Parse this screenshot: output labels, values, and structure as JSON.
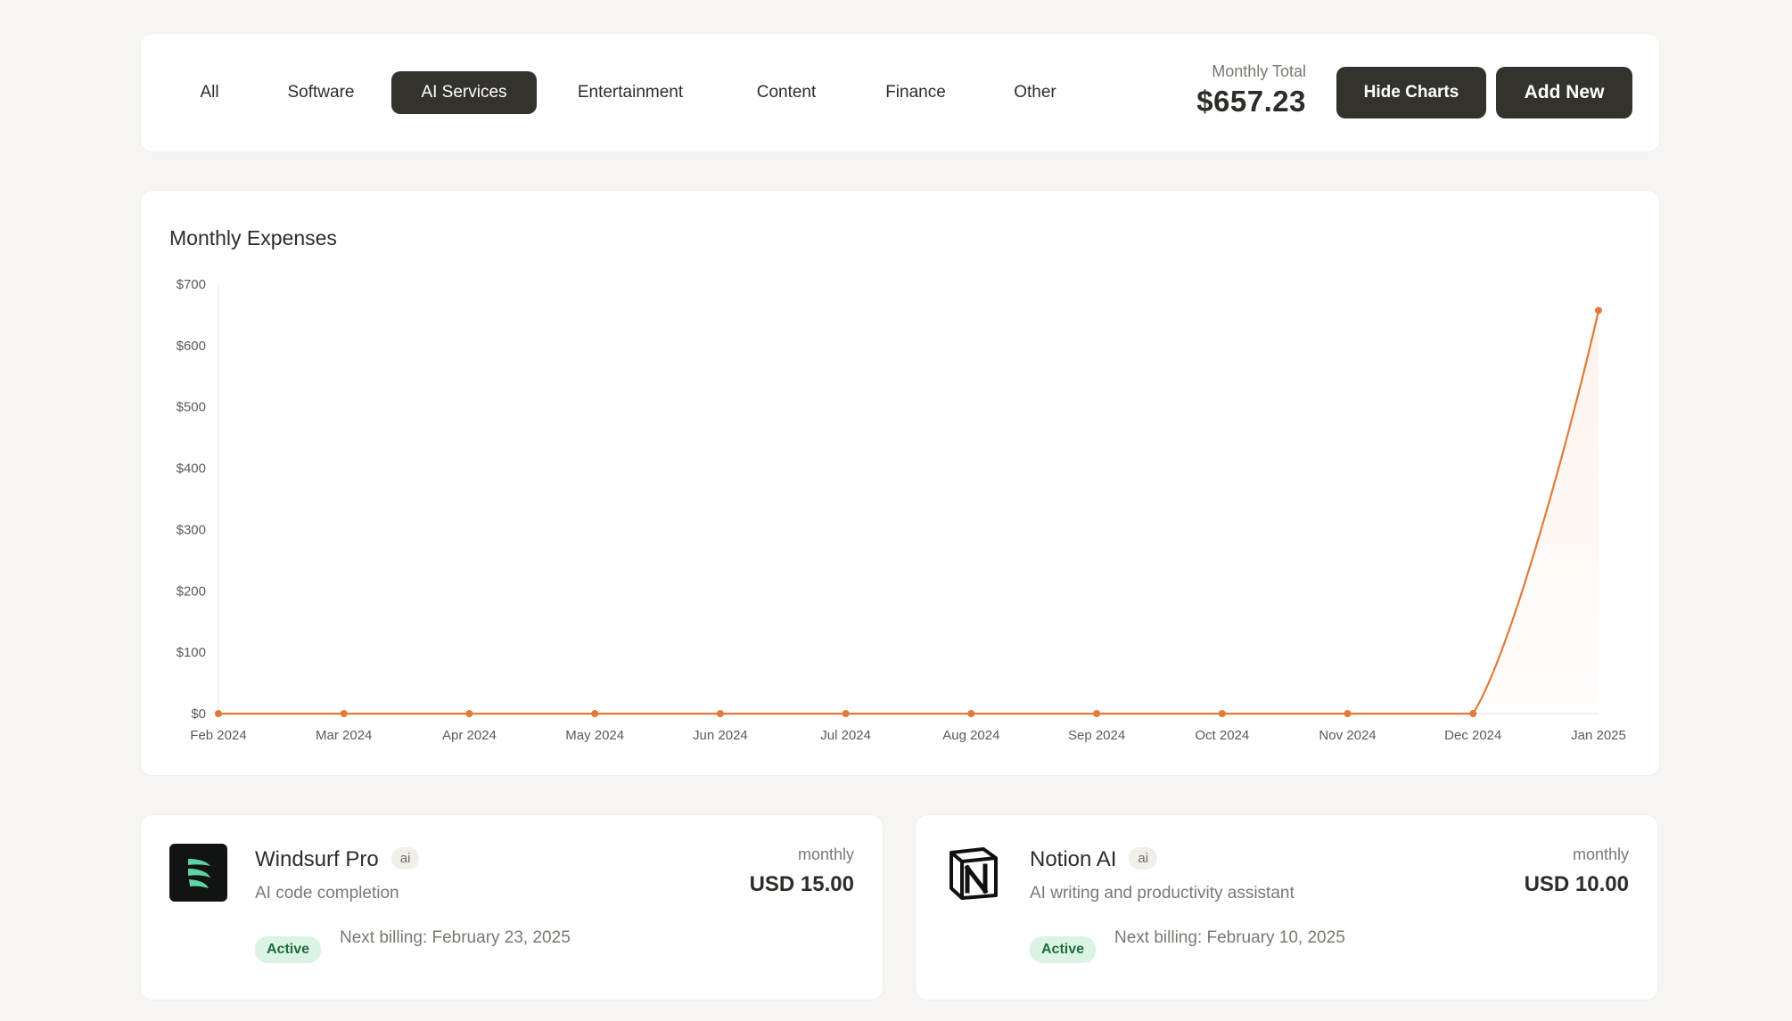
{
  "tabs": [
    {
      "label": "All"
    },
    {
      "label": "Software"
    },
    {
      "label": "AI Services",
      "active": true
    },
    {
      "label": "Entertainment"
    },
    {
      "label": "Content"
    },
    {
      "label": "Finance"
    },
    {
      "label": "Other"
    }
  ],
  "summary": {
    "total_label": "Monthly Total",
    "total_value": "$657.23"
  },
  "buttons": {
    "hide_charts": "Hide Charts",
    "add_new": "Add New"
  },
  "chart": {
    "title": "Monthly Expenses"
  },
  "chart_data": {
    "type": "area",
    "title": "Monthly Expenses",
    "xlabel": "",
    "ylabel": "",
    "categories": [
      "Feb 2024",
      "Mar 2024",
      "Apr 2024",
      "May 2024",
      "Jun 2024",
      "Jul 2024",
      "Aug 2024",
      "Sep 2024",
      "Oct 2024",
      "Nov 2024",
      "Dec 2024",
      "Jan 2025"
    ],
    "values": [
      0,
      0,
      0,
      0,
      0,
      0,
      0,
      0,
      0,
      0,
      0,
      657.23
    ],
    "ylim": [
      0,
      700
    ],
    "yticks": [
      0,
      100,
      200,
      300,
      400,
      500,
      600,
      700
    ],
    "ytick_labels": [
      "$0",
      "$100",
      "$200",
      "$300",
      "$400",
      "$500",
      "$600",
      "$700"
    ],
    "grid": false,
    "line_color": "#e07b39"
  },
  "subscriptions": [
    {
      "name": "Windsurf Pro",
      "tag": "ai",
      "description": "AI code completion",
      "status": "Active",
      "next_billing": "Next billing: February 23, 2025",
      "period": "monthly",
      "price": "USD 15.00",
      "icon": "windsurf-logo"
    },
    {
      "name": "Notion AI",
      "tag": "ai",
      "description": "AI writing and productivity assistant",
      "status": "Active",
      "next_billing": "Next billing: February 10, 2025",
      "period": "monthly",
      "price": "USD 10.00",
      "icon": "notion-logo"
    }
  ]
}
